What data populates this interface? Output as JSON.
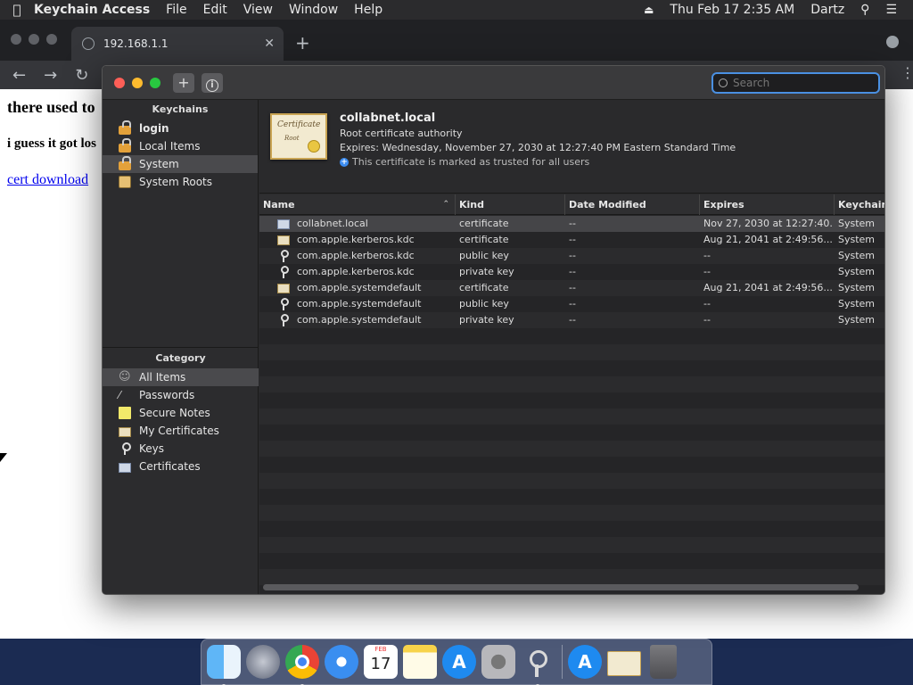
{
  "menubar": {
    "app_name": "Keychain Access",
    "menus": [
      "File",
      "Edit",
      "View",
      "Window",
      "Help"
    ],
    "clock": "Thu Feb 17  2:35 AM",
    "user": "Dartz"
  },
  "browser": {
    "tab_title": "192.168.1.1",
    "page": {
      "heading1": "there used to",
      "heading2": "i guess it got los",
      "link": "cert download"
    }
  },
  "keychain": {
    "search_placeholder": "Search",
    "sidebar": {
      "keychains_header": "Keychains",
      "keychains": [
        {
          "label": "login",
          "icon": "lock-open-icon"
        },
        {
          "label": "Local Items",
          "icon": "lock-open-icon"
        },
        {
          "label": "System",
          "icon": "lock-icon"
        },
        {
          "label": "System Roots",
          "icon": "folder-icon"
        }
      ],
      "category_header": "Category",
      "categories": [
        {
          "label": "All Items",
          "icon": "all-items-icon"
        },
        {
          "label": "Passwords",
          "icon": "password-icon"
        },
        {
          "label": "Secure Notes",
          "icon": "note-icon"
        },
        {
          "label": "My Certificates",
          "icon": "certificate-icon"
        },
        {
          "label": "Keys",
          "icon": "key-icon"
        },
        {
          "label": "Certificates",
          "icon": "certificates-icon"
        }
      ]
    },
    "detail": {
      "cert_caption": "Certificate",
      "cert_root": "Root",
      "name": "collabnet.local",
      "type": "Root certificate authority",
      "expires": "Expires: Wednesday, November 27, 2030 at 12:27:40 PM Eastern Standard Time",
      "trust": "This certificate is marked as trusted for all users"
    },
    "table": {
      "columns": [
        "Name",
        "Kind",
        "Date Modified",
        "Expires",
        "Keychain"
      ],
      "rows": [
        {
          "name": "collabnet.local",
          "kind": "certificate",
          "modified": "--",
          "expires": "Nov 27, 2030 at 12:27:40...",
          "keychain": "System",
          "icon": "certificate-trusted-icon"
        },
        {
          "name": "com.apple.kerberos.kdc",
          "kind": "certificate",
          "modified": "--",
          "expires": "Aug 21, 2041 at 2:49:56...",
          "keychain": "System",
          "icon": "certificate-icon"
        },
        {
          "name": "com.apple.kerberos.kdc",
          "kind": "public key",
          "modified": "--",
          "expires": "--",
          "keychain": "System",
          "icon": "key-icon"
        },
        {
          "name": "com.apple.kerberos.kdc",
          "kind": "private key",
          "modified": "--",
          "expires": "--",
          "keychain": "System",
          "icon": "key-icon"
        },
        {
          "name": "com.apple.systemdefault",
          "kind": "certificate",
          "modified": "--",
          "expires": "Aug 21, 2041 at 2:49:56...",
          "keychain": "System",
          "icon": "certificate-icon"
        },
        {
          "name": "com.apple.systemdefault",
          "kind": "public key",
          "modified": "--",
          "expires": "--",
          "keychain": "System",
          "icon": "key-icon"
        },
        {
          "name": "com.apple.systemdefault",
          "kind": "private key",
          "modified": "--",
          "expires": "--",
          "keychain": "System",
          "icon": "key-icon"
        }
      ]
    }
  },
  "dock": {
    "calendar_month": "FEB",
    "calendar_day": "17",
    "apps": [
      "finder-icon",
      "launchpad-icon",
      "chrome-icon",
      "safari-icon",
      "calendar-icon",
      "notes-icon",
      "app-store-icon",
      "system-preferences-icon",
      "keychain-access-icon",
      "app-store-downloads-icon",
      "certificate-file-icon",
      "trash-icon"
    ]
  },
  "colors": {
    "accent": "#4a90e2",
    "selection": "#4a4a4d",
    "trusted": "#3b8cf0"
  }
}
